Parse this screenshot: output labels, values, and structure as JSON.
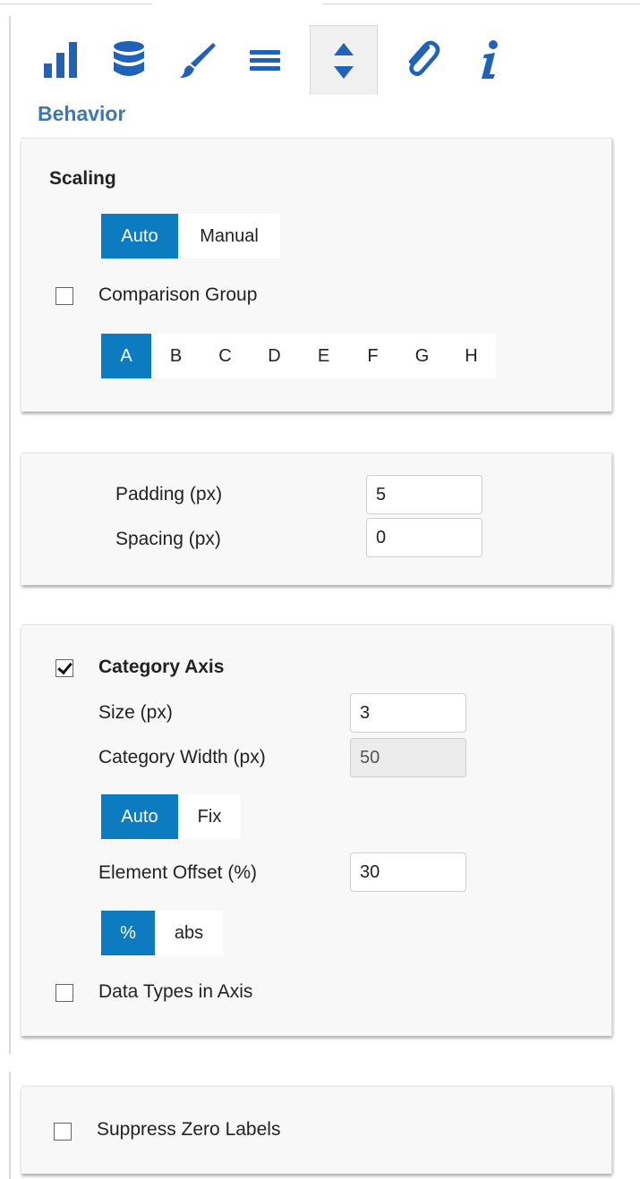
{
  "colors": {
    "accent": "#0c7bc0",
    "section_title": "#3d78b3",
    "icon_blue": "#1f62b8"
  },
  "toolbar": {
    "icons": [
      "bar-chart-icon",
      "database-icon",
      "brush-icon",
      "menu-lines-icon",
      "sort-arrows-icon",
      "paperclip-icon",
      "info-icon"
    ],
    "active_index": 4
  },
  "section_title": "Behavior",
  "scaling": {
    "title": "Scaling",
    "mode_options": [
      "Auto",
      "Manual"
    ],
    "mode_selected": "Auto",
    "comparison_group": {
      "label": "Comparison Group",
      "checked": false
    },
    "groups": [
      "A",
      "B",
      "C",
      "D",
      "E",
      "F",
      "G",
      "H"
    ],
    "group_selected": "A"
  },
  "layout": {
    "padding": {
      "label": "Padding (px)",
      "value": "5"
    },
    "spacing": {
      "label": "Spacing (px)",
      "value": "0"
    }
  },
  "category_axis": {
    "label": "Category Axis",
    "checked": true,
    "size": {
      "label": "Size (px)",
      "value": "3"
    },
    "category_width": {
      "label": "Category Width (px)",
      "value": "50",
      "disabled": true
    },
    "width_mode_options": [
      "Auto",
      "Fix"
    ],
    "width_mode_selected": "Auto",
    "element_offset": {
      "label": "Element Offset (%)",
      "value": "30"
    },
    "offset_unit_options": [
      "%",
      "abs"
    ],
    "offset_unit_selected": "%",
    "data_types_in_axis": {
      "label": "Data Types in Axis",
      "checked": false
    }
  },
  "suppress_zero_labels": {
    "label": "Suppress Zero Labels",
    "checked": false
  }
}
